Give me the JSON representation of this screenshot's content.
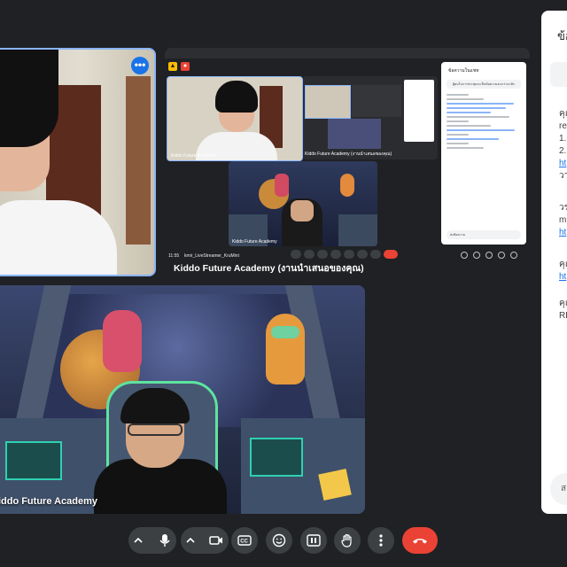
{
  "tiles": {
    "presentation": {
      "title": "Kiddo Future Academy (งานนำเสนอของคุณ)",
      "time": "11:55",
      "meeting_code": "kmir_LiveStreamer_KruMint",
      "mini_tiles": {
        "boy_name": "Kiddo Future Academy",
        "screen_title": "Kiddo Future Academy (งานนำเสนอของคุณ)",
        "space_name": "Kiddo Future Academy"
      },
      "embedded_chat": {
        "title": "ข้อความในแชท",
        "notice": "ผู้คนในการประชุมจะเห็นข้อความจนกว่าจะเลิก",
        "input_placeholder": "ส่งข้อความ"
      }
    },
    "space": {
      "name": "Kiddo Future Academy"
    }
  },
  "side_panel": {
    "header": "ข้อ",
    "messages": [
      {
        "lines": [
          "คุณ",
          "re",
          "1.",
          "2.",
          "ht",
          "วา"
        ]
      },
      {
        "lines": [
          "วร",
          "m",
          "ht"
        ]
      },
      {
        "lines": [
          "คุณ",
          "ht"
        ]
      },
      {
        "lines": [
          "คุณ",
          "RE"
        ]
      }
    ],
    "input_placeholder": "ส"
  },
  "controls": {
    "more_label": "⋯"
  },
  "colors": {
    "accent": "#8ab4f8",
    "end_call": "#ea4335",
    "background": "#202124"
  }
}
